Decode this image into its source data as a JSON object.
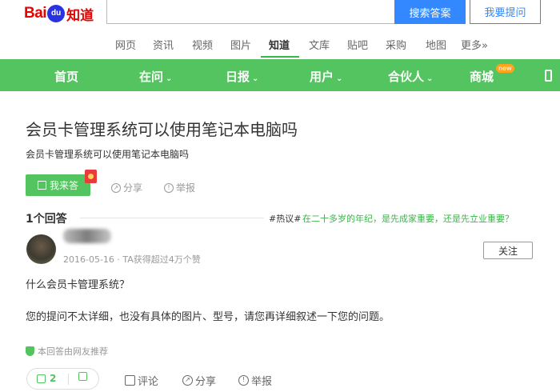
{
  "header": {
    "logo_text_a": "Bai",
    "logo_text_paw": "du",
    "logo_text_b": "知道",
    "search_value": "",
    "search_button": "搜索答案",
    "ask_button": "我要提问"
  },
  "subnav": {
    "items": [
      "网页",
      "资讯",
      "视频",
      "图片",
      "知道",
      "文库",
      "贴吧",
      "采购",
      "地图",
      "更多»"
    ],
    "active": "知道"
  },
  "greennav": {
    "items": [
      "首页",
      "在问",
      "日报",
      "用户",
      "合伙人",
      "商城"
    ],
    "new_badge": "new"
  },
  "question": {
    "title": "会员卡管理系统可以使用笔记本电脑吗",
    "description": "会员卡管理系统可以使用笔记本电脑吗",
    "answer_button": "我来答",
    "share": "分享",
    "report": "举报"
  },
  "answers": {
    "count_label": "1个回答",
    "hot_tag": "#热议#",
    "hot_text": "在二十多岁的年纪，是先成家重要，还是先立业重要？"
  },
  "answer": {
    "meta": "2016-05-16 · TA获得超过4万个赞",
    "follow": "关注",
    "para1": "什么会员卡管理系统？",
    "para2": "您的提问不太详细，也没有具体的图片、型号，请您再详细叙述一下您的问题。",
    "recommend": "本回答由网友推荐",
    "likes": "2",
    "comment": "评论",
    "share": "分享",
    "report": "举报"
  },
  "colors": {
    "green": "#53c45f",
    "blue": "#3388ff",
    "red": "#e10601"
  }
}
